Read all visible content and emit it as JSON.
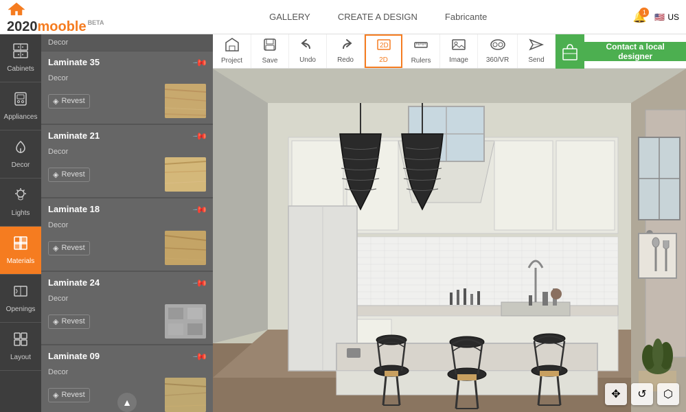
{
  "header": {
    "logo": "2020mooble",
    "logo_part1": "2020",
    "logo_part2": "mooble",
    "beta": "BETA",
    "nav": [
      {
        "label": "GALLERY",
        "id": "gallery"
      },
      {
        "label": "CREATE A DESIGN",
        "id": "create"
      },
      {
        "label": "Fabricante",
        "id": "fabricante"
      }
    ],
    "notifications_count": "1",
    "locale": "US"
  },
  "toolbar": {
    "tools": [
      {
        "id": "project",
        "icon": "🏠",
        "label": "Project"
      },
      {
        "id": "save",
        "icon": "💾",
        "label": "Save"
      },
      {
        "id": "undo",
        "icon": "↩",
        "label": "Undo"
      },
      {
        "id": "redo",
        "icon": "↪",
        "label": "Redo"
      },
      {
        "id": "2d",
        "icon": "⬜",
        "label": "2D"
      },
      {
        "id": "rulers",
        "icon": "📏",
        "label": "Rulers"
      },
      {
        "id": "image",
        "icon": "🖼",
        "label": "Image"
      },
      {
        "id": "360vr",
        "icon": "👓",
        "label": "360/VR"
      },
      {
        "id": "send",
        "icon": "✈",
        "label": "Send"
      }
    ],
    "contact_designer": "Contact a local designer"
  },
  "sidebar": {
    "items": [
      {
        "id": "cabinets",
        "icon": "▦",
        "label": "Cabinets"
      },
      {
        "id": "appliances",
        "icon": "⬡",
        "label": "Appliances"
      },
      {
        "id": "decor",
        "icon": "🌿",
        "label": "Decor"
      },
      {
        "id": "lights",
        "icon": "💡",
        "label": "Lights"
      },
      {
        "id": "materials",
        "icon": "◧",
        "label": "Materials",
        "active": true
      },
      {
        "id": "openings",
        "icon": "▭",
        "label": "Openings"
      },
      {
        "id": "layout",
        "icon": "⊞",
        "label": "Layout"
      }
    ]
  },
  "materials_panel": {
    "decor_header": "Decor",
    "items": [
      {
        "id": "lam35",
        "name": "Laminate 35",
        "category": "Decor",
        "revest_label": "Revest",
        "thumb_class": "thumb-wood1"
      },
      {
        "id": "lam21",
        "name": "Laminate 21",
        "category": "Decor",
        "revest_label": "Revest",
        "thumb_class": "thumb-wood2"
      },
      {
        "id": "lam18",
        "name": "Laminate 18",
        "category": "Decor",
        "revest_label": "Revest",
        "thumb_class": "thumb-wood3"
      },
      {
        "id": "lam24",
        "name": "Laminate 24",
        "category": "Decor",
        "revest_label": "Revest",
        "thumb_class": "thumb-gray"
      },
      {
        "id": "lam09",
        "name": "Laminate 09",
        "category": "Decor",
        "revest_label": "Revest",
        "thumb_class": "thumb-wood4"
      }
    ]
  },
  "bottom_controls": {
    "move_icon": "✥",
    "refresh_icon": "↺",
    "cube_icon": "⬡"
  }
}
